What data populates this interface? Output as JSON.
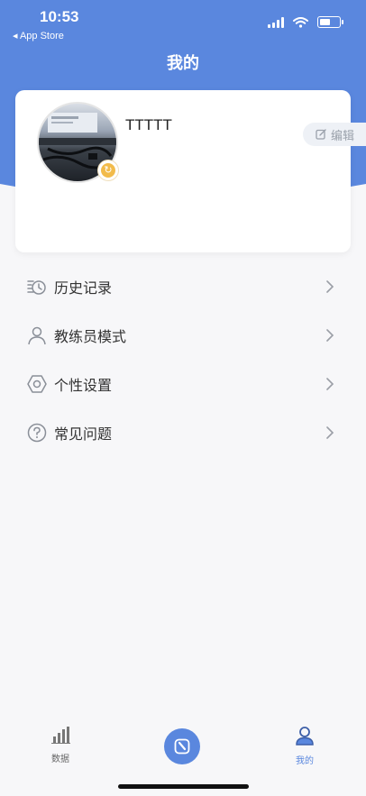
{
  "status_bar": {
    "time": "10:53",
    "back_app": "◂ App Store"
  },
  "page": {
    "title": "我的"
  },
  "profile": {
    "username": "TTTTT",
    "edit_label": "编辑"
  },
  "menu": {
    "items": [
      {
        "label": "历史记录",
        "icon": "history-icon"
      },
      {
        "label": "教练员模式",
        "icon": "person-icon"
      },
      {
        "label": "个性设置",
        "icon": "settings-icon"
      },
      {
        "label": "常见问题",
        "icon": "question-icon"
      }
    ]
  },
  "tab_bar": {
    "tabs": [
      {
        "label": "数据",
        "icon": "bar-chart-icon",
        "active": false
      },
      {
        "label": "",
        "icon": "timer-icon",
        "active": false
      },
      {
        "label": "我的",
        "icon": "user-icon",
        "active": true
      }
    ]
  },
  "colors": {
    "primary": "#5a87de",
    "inactive": "#666666",
    "background": "#f7f7f9"
  }
}
